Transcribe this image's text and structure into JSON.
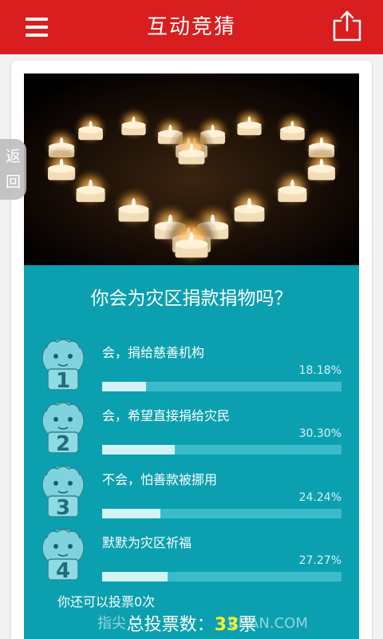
{
  "header": {
    "title": "互动竞猜",
    "menu_icon": "hamburger-menu-icon",
    "share_icon": "share-export-icon"
  },
  "back_tab": {
    "char1": "返",
    "char2": "回"
  },
  "hero": {
    "subject": "candles-heart-photo"
  },
  "poll": {
    "question": "你会为灾区捐款捐物吗？",
    "options": [
      {
        "number": "1",
        "label": "会，捐给慈善机构",
        "percent_text": "18.18%",
        "percent": 18.18
      },
      {
        "number": "2",
        "label": "会，希望直接捐给灾民",
        "percent_text": "30.30%",
        "percent": 30.3
      },
      {
        "number": "3",
        "label": "不会，怕善款被挪用",
        "percent_text": "24.24%",
        "percent": 24.24
      },
      {
        "number": "4",
        "label": "默默为灾区祈福",
        "percent_text": "27.27%",
        "percent": 27.27
      }
    ],
    "remaining_votes_text": "你还可以投票0次",
    "total_prefix": "总投票数：",
    "total_count": "33",
    "total_suffix": "票"
  },
  "watermark": "指尖",
  "watermark_tail": "CHAN.COM",
  "colors": {
    "header": "#d81e1e",
    "panel": "#0ba0b0",
    "bar_fill": "#d2f2f6",
    "bar_track": "#3cbcca",
    "count": "#f4f12c"
  }
}
